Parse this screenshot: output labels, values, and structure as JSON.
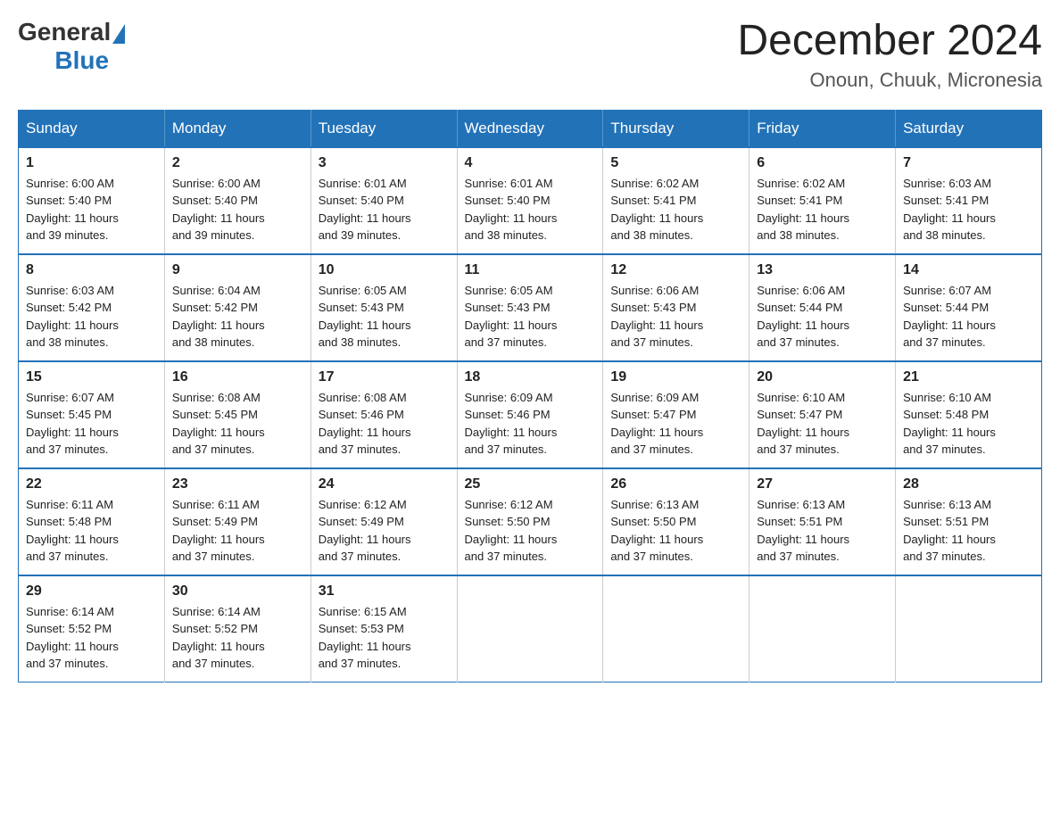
{
  "header": {
    "logo": {
      "general": "General",
      "blue": "Blue",
      "triangle_unicode": "▶"
    },
    "title": "December 2024",
    "subtitle": "Onoun, Chuuk, Micronesia"
  },
  "days_of_week": [
    "Sunday",
    "Monday",
    "Tuesday",
    "Wednesday",
    "Thursday",
    "Friday",
    "Saturday"
  ],
  "weeks": [
    [
      {
        "day": "1",
        "sunrise": "6:00 AM",
        "sunset": "5:40 PM",
        "daylight": "11 hours and 39 minutes."
      },
      {
        "day": "2",
        "sunrise": "6:00 AM",
        "sunset": "5:40 PM",
        "daylight": "11 hours and 39 minutes."
      },
      {
        "day": "3",
        "sunrise": "6:01 AM",
        "sunset": "5:40 PM",
        "daylight": "11 hours and 39 minutes."
      },
      {
        "day": "4",
        "sunrise": "6:01 AM",
        "sunset": "5:40 PM",
        "daylight": "11 hours and 38 minutes."
      },
      {
        "day": "5",
        "sunrise": "6:02 AM",
        "sunset": "5:41 PM",
        "daylight": "11 hours and 38 minutes."
      },
      {
        "day": "6",
        "sunrise": "6:02 AM",
        "sunset": "5:41 PM",
        "daylight": "11 hours and 38 minutes."
      },
      {
        "day": "7",
        "sunrise": "6:03 AM",
        "sunset": "5:41 PM",
        "daylight": "11 hours and 38 minutes."
      }
    ],
    [
      {
        "day": "8",
        "sunrise": "6:03 AM",
        "sunset": "5:42 PM",
        "daylight": "11 hours and 38 minutes."
      },
      {
        "day": "9",
        "sunrise": "6:04 AM",
        "sunset": "5:42 PM",
        "daylight": "11 hours and 38 minutes."
      },
      {
        "day": "10",
        "sunrise": "6:05 AM",
        "sunset": "5:43 PM",
        "daylight": "11 hours and 38 minutes."
      },
      {
        "day": "11",
        "sunrise": "6:05 AM",
        "sunset": "5:43 PM",
        "daylight": "11 hours and 37 minutes."
      },
      {
        "day": "12",
        "sunrise": "6:06 AM",
        "sunset": "5:43 PM",
        "daylight": "11 hours and 37 minutes."
      },
      {
        "day": "13",
        "sunrise": "6:06 AM",
        "sunset": "5:44 PM",
        "daylight": "11 hours and 37 minutes."
      },
      {
        "day": "14",
        "sunrise": "6:07 AM",
        "sunset": "5:44 PM",
        "daylight": "11 hours and 37 minutes."
      }
    ],
    [
      {
        "day": "15",
        "sunrise": "6:07 AM",
        "sunset": "5:45 PM",
        "daylight": "11 hours and 37 minutes."
      },
      {
        "day": "16",
        "sunrise": "6:08 AM",
        "sunset": "5:45 PM",
        "daylight": "11 hours and 37 minutes."
      },
      {
        "day": "17",
        "sunrise": "6:08 AM",
        "sunset": "5:46 PM",
        "daylight": "11 hours and 37 minutes."
      },
      {
        "day": "18",
        "sunrise": "6:09 AM",
        "sunset": "5:46 PM",
        "daylight": "11 hours and 37 minutes."
      },
      {
        "day": "19",
        "sunrise": "6:09 AM",
        "sunset": "5:47 PM",
        "daylight": "11 hours and 37 minutes."
      },
      {
        "day": "20",
        "sunrise": "6:10 AM",
        "sunset": "5:47 PM",
        "daylight": "11 hours and 37 minutes."
      },
      {
        "day": "21",
        "sunrise": "6:10 AM",
        "sunset": "5:48 PM",
        "daylight": "11 hours and 37 minutes."
      }
    ],
    [
      {
        "day": "22",
        "sunrise": "6:11 AM",
        "sunset": "5:48 PM",
        "daylight": "11 hours and 37 minutes."
      },
      {
        "day": "23",
        "sunrise": "6:11 AM",
        "sunset": "5:49 PM",
        "daylight": "11 hours and 37 minutes."
      },
      {
        "day": "24",
        "sunrise": "6:12 AM",
        "sunset": "5:49 PM",
        "daylight": "11 hours and 37 minutes."
      },
      {
        "day": "25",
        "sunrise": "6:12 AM",
        "sunset": "5:50 PM",
        "daylight": "11 hours and 37 minutes."
      },
      {
        "day": "26",
        "sunrise": "6:13 AM",
        "sunset": "5:50 PM",
        "daylight": "11 hours and 37 minutes."
      },
      {
        "day": "27",
        "sunrise": "6:13 AM",
        "sunset": "5:51 PM",
        "daylight": "11 hours and 37 minutes."
      },
      {
        "day": "28",
        "sunrise": "6:13 AM",
        "sunset": "5:51 PM",
        "daylight": "11 hours and 37 minutes."
      }
    ],
    [
      {
        "day": "29",
        "sunrise": "6:14 AM",
        "sunset": "5:52 PM",
        "daylight": "11 hours and 37 minutes."
      },
      {
        "day": "30",
        "sunrise": "6:14 AM",
        "sunset": "5:52 PM",
        "daylight": "11 hours and 37 minutes."
      },
      {
        "day": "31",
        "sunrise": "6:15 AM",
        "sunset": "5:53 PM",
        "daylight": "11 hours and 37 minutes."
      },
      null,
      null,
      null,
      null
    ]
  ],
  "colors": {
    "header_bg": "#2272b8",
    "border": "#2272b8"
  },
  "labels": {
    "sunrise_prefix": "Sunrise: ",
    "sunset_prefix": "Sunset: ",
    "daylight_prefix": "Daylight: "
  }
}
